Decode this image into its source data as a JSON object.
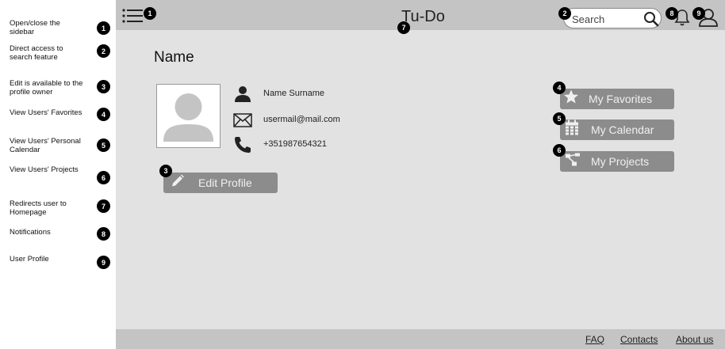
{
  "legend": [
    {
      "text": "Open/close the sidebar",
      "num": "1"
    },
    {
      "text": "Direct access to search feature",
      "num": "2"
    },
    {
      "text": "Edit is available to the profile owner",
      "num": "3"
    },
    {
      "text": "View Users' Favorites",
      "num": "4"
    },
    {
      "text": "View Users' Personal Calendar",
      "num": "5"
    },
    {
      "text": "View Users' Projects",
      "num": "6"
    },
    {
      "text": "Redirects user to Homepage",
      "num": "7"
    },
    {
      "text": "Notifications",
      "num": "8"
    },
    {
      "text": "User Profile",
      "num": "9"
    }
  ],
  "header": {
    "title": "Tu-Do",
    "search_placeholder": "Search",
    "menu_icon": "hamburger-menu-icon",
    "search_icon": "magnifier-icon",
    "bell_icon": "bell-icon",
    "user_icon": "user-icon"
  },
  "badges": {
    "menu": "1",
    "search": "2",
    "edit": "3",
    "favorites": "4",
    "calendar": "5",
    "projects": "6",
    "title": "7",
    "notifications": "8",
    "user": "9"
  },
  "profile": {
    "name_heading": "Name",
    "full_name": "Name Surname",
    "email": "usermail@mail.com",
    "phone": "+351987654321",
    "edit_label": "Edit Profile"
  },
  "actions": {
    "favorites": "My Favorites",
    "calendar": "My Calendar",
    "projects": "My Projects"
  },
  "footer": {
    "faq": "FAQ",
    "contacts": "Contacts",
    "about": "About us"
  },
  "colors": {
    "app_bg": "#e2e2e2",
    "bar_bg": "#c4c4c4",
    "button_bg": "#8c8c8c",
    "badge_bg": "#000000"
  }
}
